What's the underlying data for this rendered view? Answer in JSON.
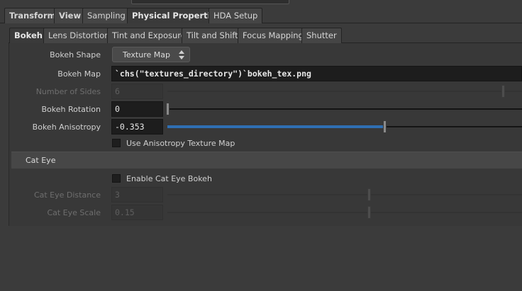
{
  "main_tabs": [
    {
      "label": "Transform"
    },
    {
      "label": "View"
    },
    {
      "label": "Sampling"
    },
    {
      "label": "Physical Properties"
    },
    {
      "label": "HDA Setup"
    }
  ],
  "sub_tabs": [
    {
      "label": "Bokeh"
    },
    {
      "label": "Lens Distortion"
    },
    {
      "label": "Tint and Exposure"
    },
    {
      "label": "Tilt and Shift"
    },
    {
      "label": "Focus Mapping"
    },
    {
      "label": "Shutter"
    }
  ],
  "params": {
    "bokeh_shape": {
      "label": "Bokeh Shape",
      "value": "Texture Map"
    },
    "bokeh_map": {
      "label": "Bokeh Map",
      "value": "`chs(\"textures_directory\")`bokeh_tex.png"
    },
    "number_of_sides": {
      "label": "Number of Sides",
      "value": "6"
    },
    "bokeh_rotation": {
      "label": "Bokeh Rotation",
      "value": "0"
    },
    "bokeh_anisotropy": {
      "label": "Bokeh Anisotropy",
      "value": "-0.353"
    },
    "use_aniso_tex": {
      "label": "Use Anisotropy Texture Map",
      "checked": false
    }
  },
  "cat_eye": {
    "title": "Cat Eye",
    "enable": {
      "label": "Enable Cat Eye Bokeh",
      "checked": false
    },
    "distance": {
      "label": "Cat Eye Distance",
      "value": "3"
    },
    "scale": {
      "label": "Cat Eye Scale",
      "value": "0.15"
    }
  },
  "colors": {
    "accent": "#2f6fb2",
    "background": "#3b3b3b"
  }
}
